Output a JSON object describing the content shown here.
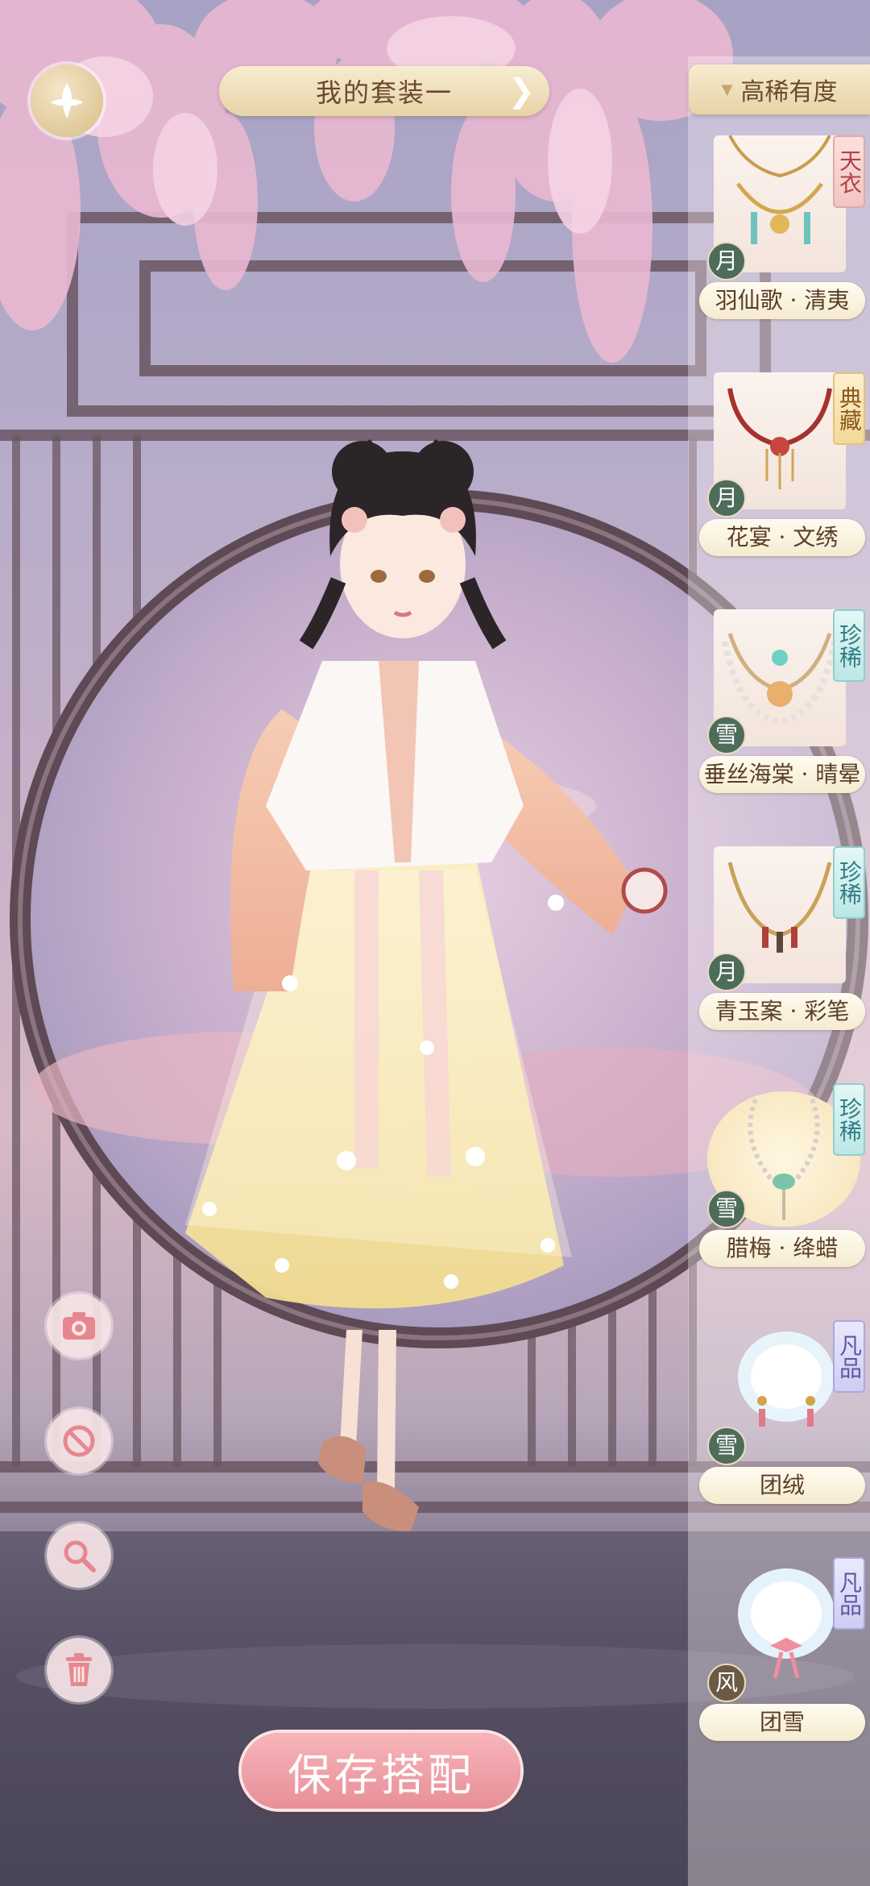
{
  "header": {
    "outfit_title": "我的套装一",
    "sort_label": "高稀有度"
  },
  "items": [
    {
      "name": "羽仙歌 · 清夷",
      "rarity": "天衣",
      "season": "月",
      "type": "necklace"
    },
    {
      "name": "花宴 · 文绣",
      "rarity": "典藏",
      "season": "月",
      "type": "necklace"
    },
    {
      "name": "垂丝海棠 · 晴晕",
      "rarity": "珍稀",
      "season": "雪",
      "type": "necklace"
    },
    {
      "name": "青玉案 · 彩笔",
      "rarity": "珍稀",
      "season": "月",
      "type": "necklace"
    },
    {
      "name": "腊梅 · 绛蜡",
      "rarity": "珍稀",
      "season": "雪",
      "type": "necklace"
    },
    {
      "name": "团绒",
      "rarity": "凡品",
      "season": "雪",
      "type": "muff"
    },
    {
      "name": "团雪",
      "rarity": "凡品",
      "season": "风",
      "type": "muff"
    }
  ],
  "tools": [
    {
      "icon": "camera-icon"
    },
    {
      "icon": "no-entry-icon"
    },
    {
      "icon": "magnifier-icon"
    },
    {
      "icon": "trash-icon"
    }
  ],
  "save_button": "保存搭配",
  "colors": {
    "accent_gold": "#e7d3a6",
    "save_pink": "#e88f98",
    "rarity_tianyi": "#b0434a",
    "rarity_diancang": "#8a5a1a",
    "rarity_zhenxi": "#2f7e86",
    "rarity_fanpin": "#5b58a6"
  }
}
